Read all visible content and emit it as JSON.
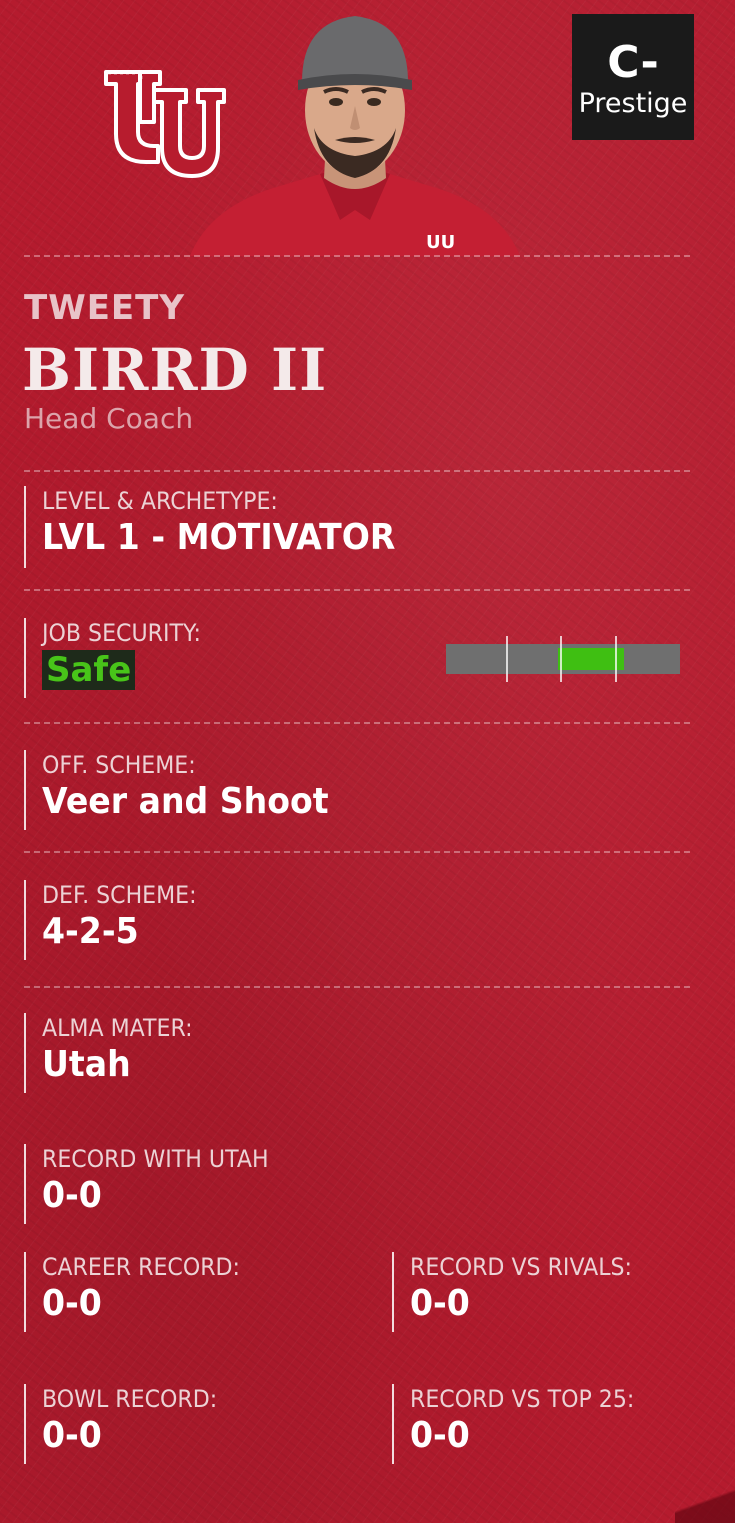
{
  "prestige": {
    "grade": "C-",
    "label": "Prestige"
  },
  "coach": {
    "first_name": "TWEETY",
    "last_name": "BIRRD II",
    "role": "Head Coach"
  },
  "fields": {
    "level_archetype": {
      "label": "LEVEL & ARCHETYPE:",
      "value": "LVL 1 - MOTIVATOR"
    },
    "job_security": {
      "label": "JOB SECURITY:",
      "value": "Safe",
      "level_fraction": 0.62
    },
    "off_scheme": {
      "label": "OFF. SCHEME:",
      "value": "Veer and Shoot"
    },
    "def_scheme": {
      "label": "DEF. SCHEME:",
      "value": "4-2-5"
    },
    "alma_mater": {
      "label": "ALMA MATER:",
      "value": "Utah"
    },
    "record_with_team": {
      "label": "RECORD WITH UTAH",
      "value": "0-0"
    },
    "career_record": {
      "label": "CAREER RECORD:",
      "value": "0-0"
    },
    "record_vs_rivals": {
      "label": "RECORD VS RIVALS:",
      "value": "0-0"
    },
    "bowl_record": {
      "label": "BOWL RECORD:",
      "value": "0-0"
    },
    "record_vs_top25": {
      "label": "RECORD VS TOP 25:",
      "value": "0-0"
    }
  },
  "colors": {
    "background": "#b51b2e",
    "safe_green": "#48c419",
    "bar_gray": "#6f6f6f",
    "prestige_box": "#1a1a1a"
  },
  "icons": {
    "team_logo": "utah-interlocking-u-logo",
    "portrait": "coach-avatar"
  }
}
